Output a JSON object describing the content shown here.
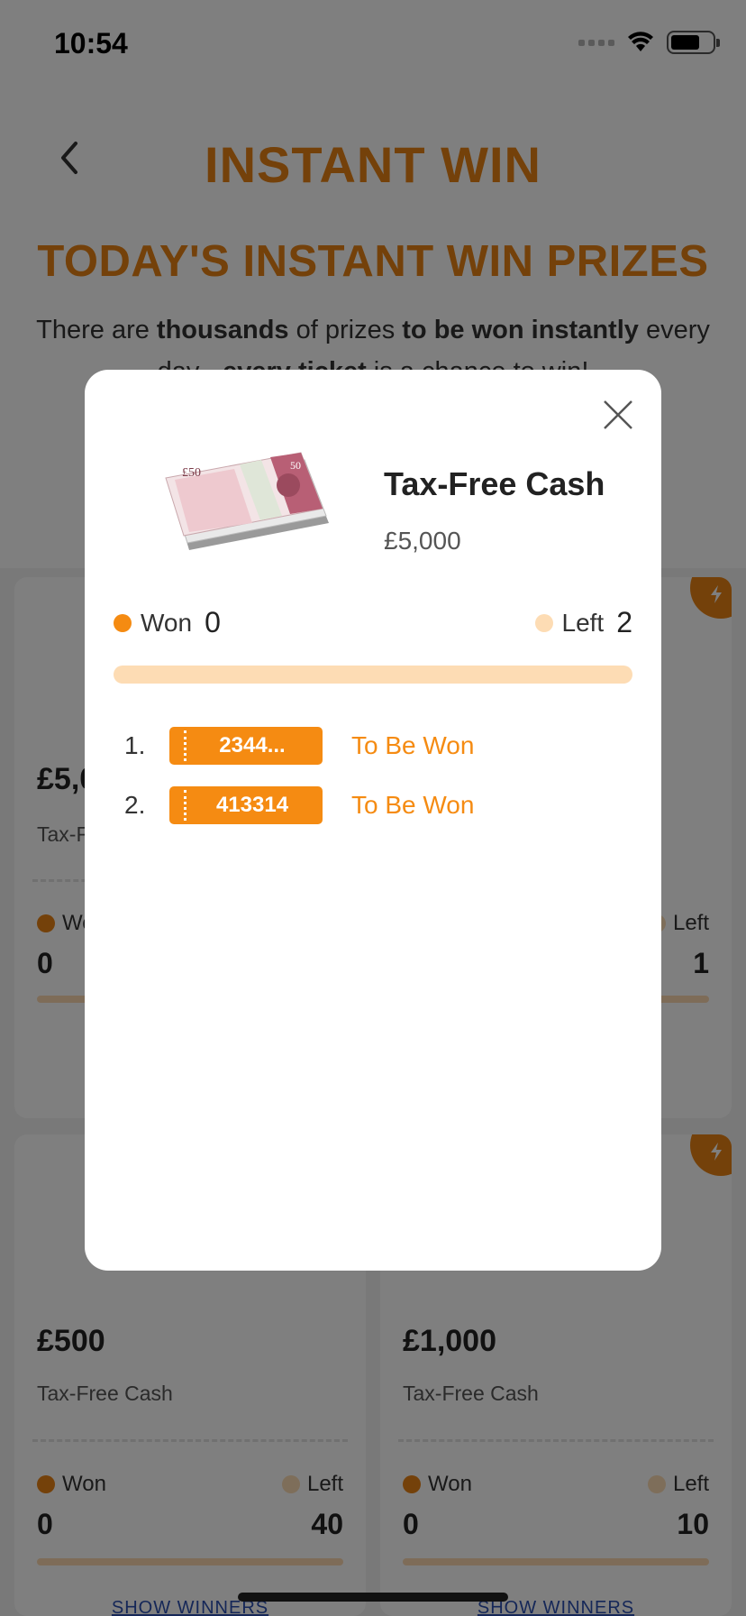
{
  "status_bar": {
    "time": "10:54"
  },
  "header": {
    "title": "INSTANT WIN"
  },
  "section": {
    "title": "TODAY'S INSTANT WIN PRIZES",
    "intro_parts": [
      "There are ",
      "thousands",
      " of prizes ",
      "to be won instantly",
      " every day - ",
      "every ticket",
      " is a chance to win!"
    ]
  },
  "cards": [
    {
      "price": "£5,000",
      "subtitle": "Tax-Free Cash",
      "won_label": "Won",
      "won_count": "0",
      "left_label": "Left",
      "left_count": "1"
    },
    {
      "price": "£500",
      "subtitle": "Tax-Free Cash",
      "won_label": "Won",
      "won_count": "0",
      "left_label": "Left",
      "left_count": "40",
      "show_winners": "SHOW WINNERS"
    },
    {
      "price": "£1,000",
      "subtitle": "Tax-Free Cash",
      "won_label": "Won",
      "won_count": "0",
      "left_label": "Left",
      "left_count": "10",
      "show_winners": "SHOW WINNERS"
    }
  ],
  "modal": {
    "prize_name": "Tax-Free Cash",
    "prize_value": "£5,000",
    "won_label": "Won",
    "won_count": "0",
    "left_label": "Left",
    "left_count": "2",
    "progress_fraction": 0,
    "tickets": [
      {
        "index": "1.",
        "number": "2344...",
        "status": "To Be Won"
      },
      {
        "index": "2.",
        "number": "413314",
        "status": "To Be Won"
      }
    ]
  },
  "colors": {
    "accent": "#e98314",
    "ticket": "#f58b12",
    "left_dot": "#fddcb4",
    "progress_track": "#fddcb4"
  }
}
